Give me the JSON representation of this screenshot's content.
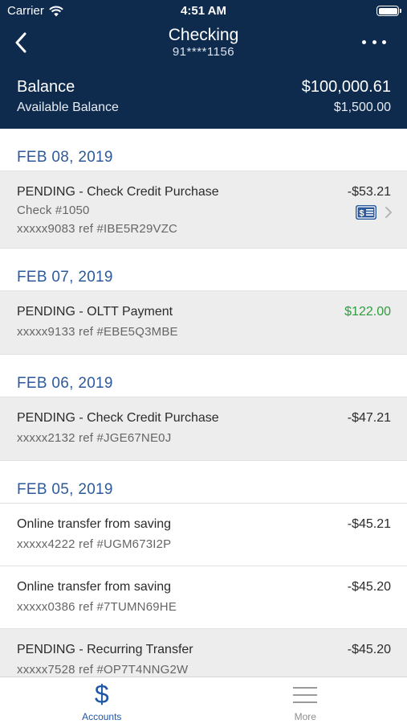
{
  "status_bar": {
    "carrier": "Carrier",
    "time": "4:51 AM"
  },
  "nav": {
    "title": "Checking",
    "subtitle": "91****1156"
  },
  "summary": {
    "balance_label": "Balance",
    "balance_value": "$100,000.61",
    "available_label": "Available Balance",
    "available_value": "$1,500.00"
  },
  "groups": [
    {
      "date": "FEB 08, 2019",
      "transactions": [
        {
          "description": "PENDING - Check Credit Purchase",
          "check": "Check #1050",
          "ref": "xxxxx9083 ref #IBE5R29VZC",
          "amount": "-$53.21",
          "pending": true,
          "has_check_image": true
        }
      ]
    },
    {
      "date": "FEB 07, 2019",
      "transactions": [
        {
          "description": "PENDING - OLTT Payment",
          "ref": "xxxxx9133 ref #EBE5Q3MBE",
          "amount": "$122.00",
          "pending": true,
          "credit": true
        }
      ]
    },
    {
      "date": "FEB 06, 2019",
      "transactions": [
        {
          "description": "PENDING - Check Credit Purchase",
          "ref": "xxxxx2132 ref #JGE67NE0J",
          "amount": "-$47.21",
          "pending": true
        }
      ]
    },
    {
      "date": "FEB 05, 2019",
      "transactions": [
        {
          "description": "Online transfer from saving",
          "ref": "xxxxx4222 ref #UGM673I2P",
          "amount": "-$45.21",
          "pending": false
        },
        {
          "description": "Online transfer from saving",
          "ref": "xxxxx0386 ref #7TUMN69HE",
          "amount": "-$45.20",
          "pending": false
        },
        {
          "description": "PENDING - Recurring Transfer",
          "ref": "xxxxx7528 ref #OP7T4NNG2W",
          "amount": "-$45.20",
          "pending": true
        }
      ]
    }
  ],
  "tabs": [
    {
      "label": "Accounts",
      "icon": "dollar-icon",
      "active": true
    },
    {
      "label": "More",
      "icon": "menu-icon",
      "active": false
    }
  ],
  "colors": {
    "header_bg": "#0e2a4d",
    "date_text": "#2d5a9c",
    "credit_amount": "#2f9d3e",
    "pending_row_bg": "#ededed",
    "active_tab": "#1f57a8"
  }
}
